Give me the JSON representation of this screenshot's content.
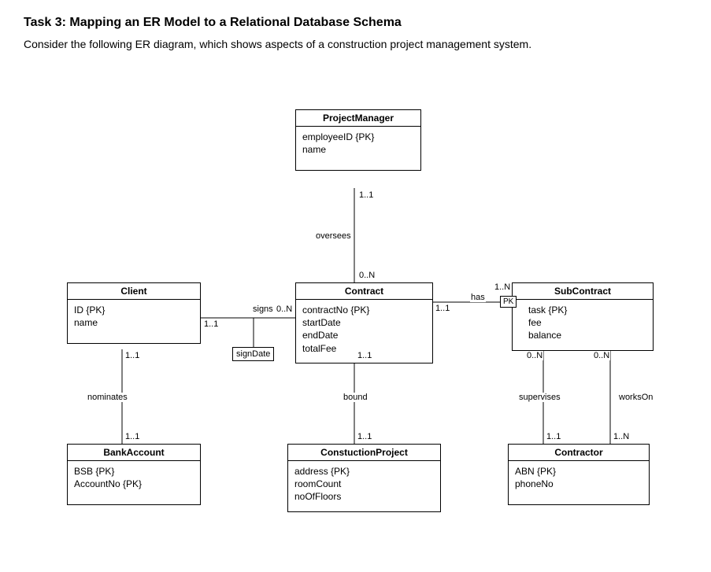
{
  "header": {
    "title": "Task 3: Mapping an ER Model to a Relational Database Schema",
    "intro": "Consider the following ER diagram, which shows aspects of a construction project management system."
  },
  "entities": {
    "projectManager": {
      "name": "ProjectManager",
      "attrs": [
        "employeeID {PK}",
        "name"
      ]
    },
    "client": {
      "name": "Client",
      "attrs": [
        "ID {PK}",
        "name"
      ]
    },
    "contract": {
      "name": "Contract",
      "attrs": [
        "contractNo {PK}",
        "startDate",
        "endDate",
        "totalFee"
      ]
    },
    "subContract": {
      "name": "SubContract",
      "attrs": [
        "task {PK}",
        "fee",
        "balance"
      ]
    },
    "bankAccount": {
      "name": "BankAccount",
      "attrs": [
        "BSB {PK}",
        "AccountNo {PK}"
      ]
    },
    "constructionProject": {
      "name": "ConstuctionProject",
      "attrs": [
        "address {PK}",
        "roomCount",
        "noOfFloors"
      ]
    },
    "contractor": {
      "name": "Contractor",
      "attrs": [
        "ABN {PK}",
        "phoneNo"
      ]
    }
  },
  "relationships": {
    "oversees": {
      "label": "oversees",
      "cardA": "1..1",
      "cardB": "0..N"
    },
    "signs": {
      "label": "signs",
      "cardA": "1..1",
      "cardB": "0..N",
      "attr": "signDate"
    },
    "has": {
      "label": "has",
      "cardA": "1..1",
      "cardB": "1..N",
      "pk": "PK"
    },
    "nominates": {
      "label": "nominates",
      "cardA": "1..1",
      "cardB": "1..1"
    },
    "bound": {
      "label": "bound",
      "cardA": "1..1",
      "cardB": "1..1"
    },
    "supervises": {
      "label": "supervises",
      "cardA": "0..N",
      "cardB": "1..1"
    },
    "worksOn": {
      "label": "worksOn",
      "cardA": "0..N",
      "cardB": "1..N"
    }
  }
}
